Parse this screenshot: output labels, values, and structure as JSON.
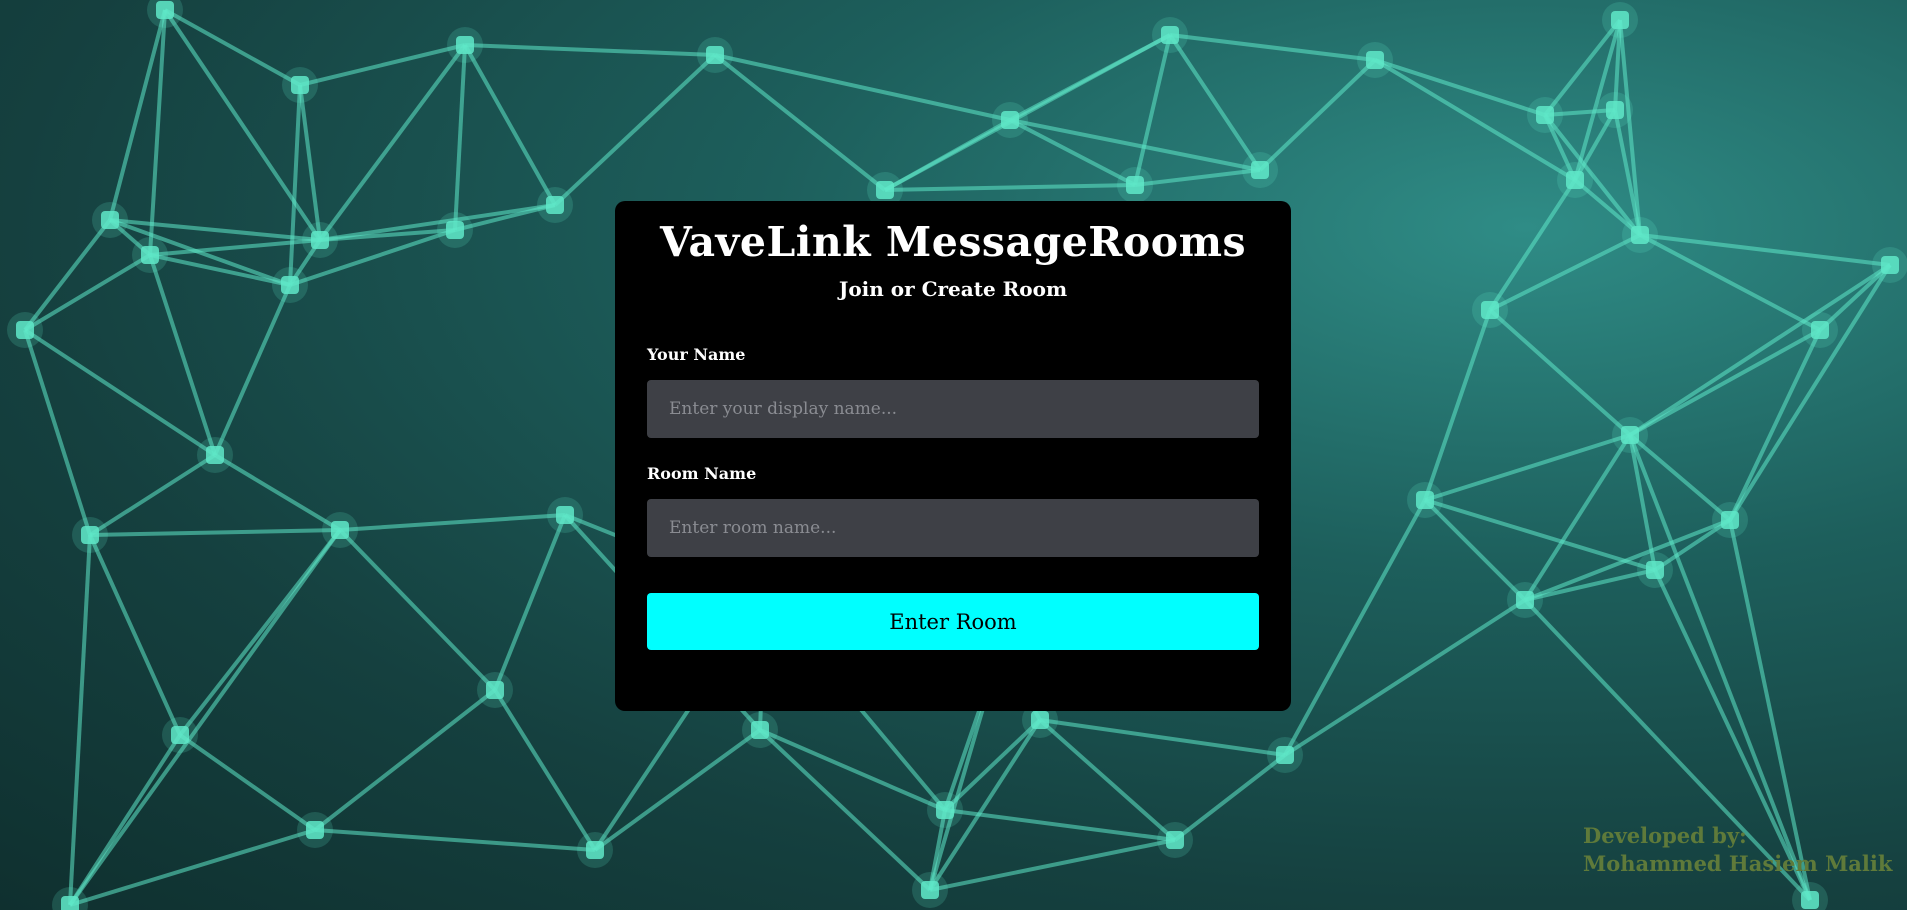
{
  "page": {
    "title": "VaveLink MessageRooms",
    "subtitle": "Join or Create Room"
  },
  "form": {
    "name_label": "Your Name",
    "name_placeholder": "Enter your display name...",
    "name_value": "",
    "room_label": "Room Name",
    "room_placeholder": "Enter room name...",
    "room_value": "",
    "submit_label": "Enter Room"
  },
  "footer": {
    "line1": "Developed by:",
    "line2": "Mohammed Hasiem Malik"
  },
  "colors": {
    "card_background": "#000000",
    "input_background": "#3e4046",
    "accent": "#00ffff",
    "credit_text": "#5f7a3a",
    "background_network": "#5fe8c8"
  }
}
